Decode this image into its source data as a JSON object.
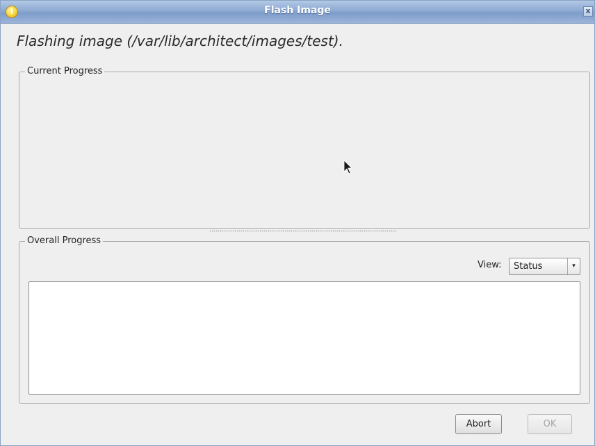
{
  "window": {
    "title": "Flash Image",
    "title_icon_glyph": "!",
    "close_glyph": "x"
  },
  "heading": "Flashing image (/var/lib/architect/images/test).",
  "current_progress": {
    "label": "Current Progress"
  },
  "overall_progress": {
    "label": "Overall Progress",
    "view_label": "View:",
    "view_value": "Status",
    "view_arrow_glyph": "▾"
  },
  "buttons": {
    "abort": "Abort",
    "ok": "OK"
  },
  "icons": {
    "window_icon": "info-icon",
    "close_icon": "close-icon",
    "cursor_icon": "mouse-pointer-icon"
  },
  "colors": {
    "titlebar": "#8eaad2",
    "window_bg": "#efefef",
    "text": "#222222",
    "disabled_text": "#a5a5a5"
  }
}
